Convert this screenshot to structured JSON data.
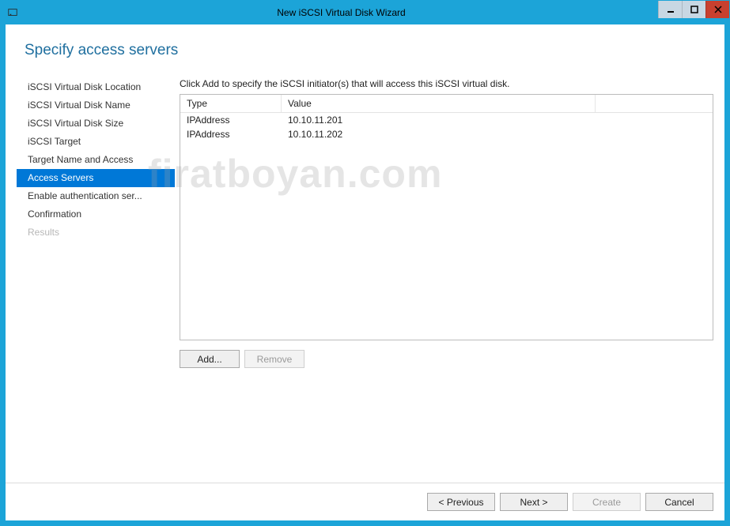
{
  "window": {
    "title": "New iSCSI Virtual Disk Wizard"
  },
  "heading": "Specify access servers",
  "sidebar": {
    "items": [
      {
        "label": "iSCSI Virtual Disk Location",
        "active": false,
        "disabled": false
      },
      {
        "label": "iSCSI Virtual Disk Name",
        "active": false,
        "disabled": false
      },
      {
        "label": "iSCSI Virtual Disk Size",
        "active": false,
        "disabled": false
      },
      {
        "label": "iSCSI Target",
        "active": false,
        "disabled": false
      },
      {
        "label": "Target Name and Access",
        "active": false,
        "disabled": false
      },
      {
        "label": "Access Servers",
        "active": true,
        "disabled": false
      },
      {
        "label": "Enable authentication ser...",
        "active": false,
        "disabled": false
      },
      {
        "label": "Confirmation",
        "active": false,
        "disabled": false
      },
      {
        "label": "Results",
        "active": false,
        "disabled": true
      }
    ]
  },
  "main": {
    "instruction": "Click Add to specify the iSCSI initiator(s) that will access this iSCSI virtual disk.",
    "columns": {
      "type": "Type",
      "value": "Value"
    },
    "rows": [
      {
        "type": "IPAddress",
        "value": "10.10.11.201"
      },
      {
        "type": "IPAddress",
        "value": "10.10.11.202"
      }
    ],
    "buttons": {
      "add": "Add...",
      "remove": "Remove"
    }
  },
  "footer": {
    "previous": "< Previous",
    "next": "Next >",
    "create": "Create",
    "cancel": "Cancel"
  },
  "watermark": "firatboyan.com"
}
